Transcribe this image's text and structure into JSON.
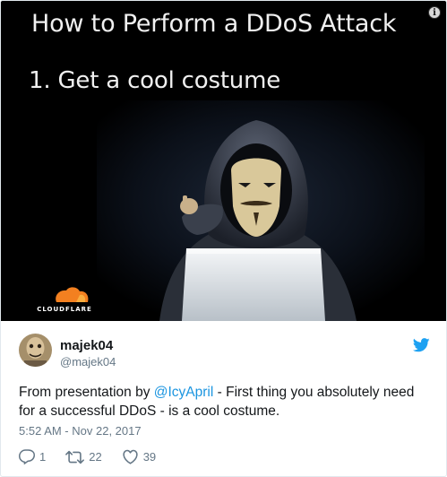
{
  "slide": {
    "title": "How to Perform a DDoS Attack",
    "point": "1.  Get a cool costume",
    "brand": "CLOUDFLARE"
  },
  "tweet": {
    "display_name": "majek04",
    "screen_name": "@majek04",
    "text_before": "From presentation by ",
    "mention": "@IcyApril",
    "text_after": " - First thing you absolutely need for a successful DDoS - is a cool costume.",
    "timestamp": "5:52 AM - Nov 22, 2017",
    "replies": "1",
    "retweets": "22",
    "likes": "39"
  },
  "icons": {
    "info": "info-icon",
    "bird": "twitter-bird-icon",
    "reply": "reply-icon",
    "retweet": "retweet-icon",
    "like": "heart-icon"
  },
  "colors": {
    "link": "#1b95e0",
    "muted": "#657786",
    "text": "#14171a",
    "cloudflare_orange": "#f38020"
  }
}
